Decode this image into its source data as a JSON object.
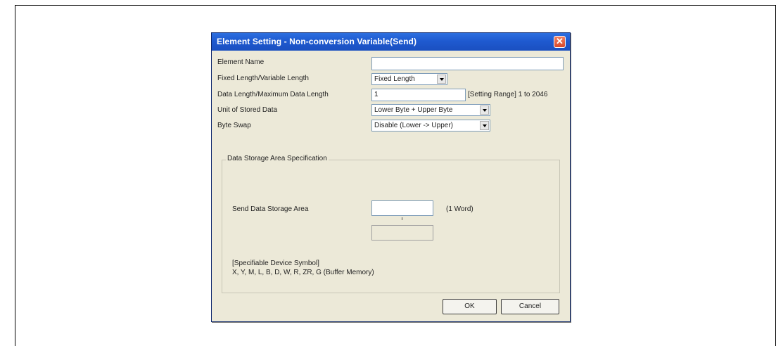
{
  "dialog": {
    "title": "Element Setting - Non-conversion Variable(Send)",
    "close_glyph": "✕",
    "fields": {
      "element_name_label": "Element Name",
      "element_name_value": "",
      "length_type_label": "Fixed Length/Variable Length",
      "length_type_value": "Fixed Length",
      "data_length_label": "Data Length/Maximum Data Length",
      "data_length_value": "1",
      "data_length_range": "[Setting Range] 1 to 2046",
      "unit_label": "Unit of Stored Data",
      "unit_value": "Lower Byte + Upper Byte",
      "byte_swap_label": "Byte Swap",
      "byte_swap_value": "Disable (Lower -> Upper)"
    },
    "storage_group": {
      "legend": "Data Storage Area Specification",
      "send_area_label": "Send Data Storage Area",
      "send_area_value": "",
      "send_area_unit": "(1 Word)",
      "range_end_value": "",
      "device_symbol_title": "[Specifiable Device Symbol]",
      "device_symbol_list": "X, Y, M, L, B, D, W, R, ZR, G (Buffer Memory)"
    },
    "buttons": {
      "ok": "OK",
      "cancel": "Cancel"
    }
  }
}
